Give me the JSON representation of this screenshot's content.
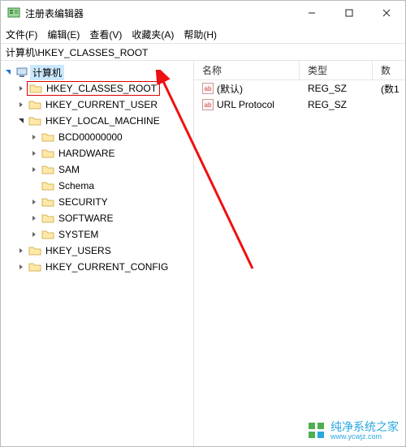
{
  "window": {
    "title": "注册表编辑器",
    "minimize": "—",
    "maximize": "□",
    "close": "✕"
  },
  "menu": {
    "file": "文件(F)",
    "edit": "编辑(E)",
    "view": "查看(V)",
    "fav": "收藏夹(A)",
    "help": "帮助(H)"
  },
  "address": "计算机\\HKEY_CLASSES_ROOT",
  "tree": {
    "root": "计算机",
    "hkcr": "HKEY_CLASSES_ROOT",
    "hkcu": "HKEY_CURRENT_USER",
    "hklm": "HKEY_LOCAL_MACHINE",
    "bcd": "BCD00000000",
    "hw": "HARDWARE",
    "sam": "SAM",
    "schema": "Schema",
    "sec": "SECURITY",
    "soft": "SOFTWARE",
    "sys": "SYSTEM",
    "hku": "HKEY_USERS",
    "hkcc": "HKEY_CURRENT_CONFIG"
  },
  "list": {
    "hdr_name": "名称",
    "hdr_type": "类型",
    "hdr_data": "数",
    "rows": [
      {
        "icon": "ab",
        "name": "(默认)",
        "type": "REG_SZ",
        "data": "(数1"
      },
      {
        "icon": "ab",
        "name": "URL Protocol",
        "type": "REG_SZ",
        "data": ""
      }
    ]
  },
  "watermark": {
    "brand": "纯净系统之家",
    "url": "www.ycwjz.com"
  }
}
